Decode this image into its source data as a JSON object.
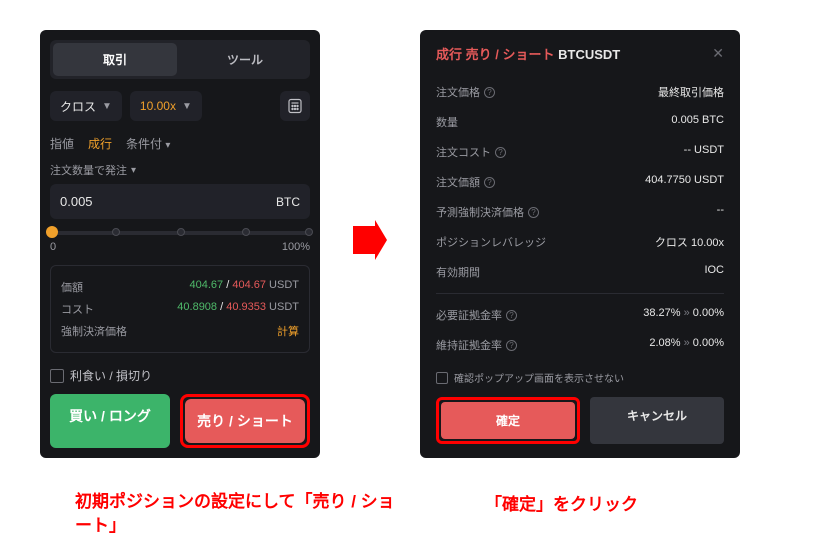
{
  "left": {
    "tabs": {
      "trade": "取引",
      "tools": "ツール"
    },
    "margin_mode": "クロス",
    "leverage": "10.00x",
    "order_types": {
      "limit": "指値",
      "market": "成行",
      "conditional": "条件付"
    },
    "qty_label": "注文数量で発注",
    "qty_value": "0.005",
    "qty_unit": "BTC",
    "slider_min": "0",
    "slider_max": "100%",
    "info": {
      "value_label": "価額",
      "value_green": "404.67",
      "value_red": "404.67",
      "value_unit": "USDT",
      "cost_label": "コスト",
      "cost_green": "40.8908",
      "cost_red": "40.9353",
      "cost_unit": "USDT",
      "liq_label": "強制決済価格",
      "liq_value": "計算"
    },
    "tpsl_label": "利食い / 損切り",
    "buy_label": "買い / ロング",
    "sell_label": "売り / ショート"
  },
  "right": {
    "title_prefix": "成行",
    "title_side": "売り / ショート",
    "title_pair": "BTCUSDT",
    "lines": {
      "price_label": "注文価格",
      "price_value": "最終取引価格",
      "qty_label": "数量",
      "qty_value": "0.005 BTC",
      "cost_label": "注文コスト",
      "cost_value": "-- USDT",
      "value_label": "注文価額",
      "value_value": "404.7750 USDT",
      "liq_label": "予測強制決済価格",
      "liq_value": "--",
      "lev_label": "ポジションレバレッジ",
      "lev_value": "クロス 10.00x",
      "tif_label": "有効期間",
      "tif_value": "IOC",
      "imr_label": "必要証拠金率",
      "imr_from": "38.27%",
      "imr_to": "0.00%",
      "mmr_label": "維持証拠金率",
      "mmr_from": "2.08%",
      "mmr_to": "0.00%"
    },
    "dont_show": "確認ポップアップ画面を表示させない",
    "confirm": "確定",
    "cancel": "キャンセル"
  },
  "captions": {
    "left": "初期ポジションの設定にして「売り / ショート」",
    "right": "「確定」をクリック"
  }
}
